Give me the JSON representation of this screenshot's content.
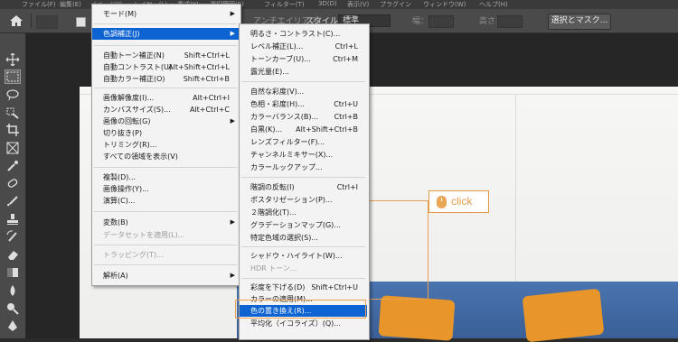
{
  "menubar": [
    "ファイル(F)",
    "編集(E)",
    "イメージ(I)",
    "レイヤー(L)",
    "書式(Y)",
    "選択範囲(S)",
    "フィルター(T)",
    "3D(D)",
    "表示(V)",
    "プラグイン",
    "ウィンドウ(W)",
    "ヘルプ(H)"
  ],
  "options": {
    "antialias": "アンチエイリアス",
    "style_label": "スタイル：",
    "style_value": "標準",
    "width_label": "幅：",
    "height_label": "高さ：",
    "select_mask": "選択とマスク..."
  },
  "image_menu": {
    "items": [
      {
        "label": "モード(M)",
        "shortcut": "",
        "submenu": true
      },
      {
        "label": "色調補正(J)",
        "shortcut": "",
        "submenu": true,
        "highlighted": true
      },
      {
        "label": "自動トーン補正(N)",
        "shortcut": "Shift+Ctrl+L"
      },
      {
        "label": "自動コントラスト(U)",
        "shortcut": "Alt+Shift+Ctrl+L"
      },
      {
        "label": "自動カラー補正(O)",
        "shortcut": "Shift+Ctrl+B"
      },
      {
        "label": "画像解像度(I)...",
        "shortcut": "Alt+Ctrl+I"
      },
      {
        "label": "カンバスサイズ(S)...",
        "shortcut": "Alt+Ctrl+C"
      },
      {
        "label": "画像の回転(G)",
        "shortcut": "",
        "submenu": true
      },
      {
        "label": "切り抜き(P)",
        "shortcut": ""
      },
      {
        "label": "トリミング(R)...",
        "shortcut": ""
      },
      {
        "label": "すべての領域を表示(V)",
        "shortcut": ""
      },
      {
        "label": "複製(D)...",
        "shortcut": ""
      },
      {
        "label": "画像操作(Y)...",
        "shortcut": ""
      },
      {
        "label": "演算(C)...",
        "shortcut": ""
      },
      {
        "label": "変数(B)",
        "shortcut": "",
        "submenu": true
      },
      {
        "label": "データセットを適用(L)...",
        "shortcut": "",
        "disabled": true
      },
      {
        "label": "トラッピング(T)...",
        "shortcut": "",
        "disabled": true
      },
      {
        "label": "解析(A)",
        "shortcut": "",
        "submenu": true
      }
    ]
  },
  "adjust_menu": {
    "items": [
      {
        "label": "明るさ・コントラスト(C)...",
        "shortcut": ""
      },
      {
        "label": "レベル補正(L)...",
        "shortcut": "Ctrl+L"
      },
      {
        "label": "トーンカーブ(U)...",
        "shortcut": "Ctrl+M"
      },
      {
        "label": "露光量(E)...",
        "shortcut": ""
      },
      {
        "label": "自然な彩度(V)...",
        "shortcut": ""
      },
      {
        "label": "色相・彩度(H)...",
        "shortcut": "Ctrl+U"
      },
      {
        "label": "カラーバランス(B)...",
        "shortcut": "Ctrl+B"
      },
      {
        "label": "白黒(K)...",
        "shortcut": "Alt+Shift+Ctrl+B"
      },
      {
        "label": "レンズフィルター(F)...",
        "shortcut": ""
      },
      {
        "label": "チャンネルミキサー(X)...",
        "shortcut": ""
      },
      {
        "label": "カラールックアップ...",
        "shortcut": ""
      },
      {
        "label": "階調の反転(I)",
        "shortcut": "Ctrl+I"
      },
      {
        "label": "ポスタリゼーション(P)...",
        "shortcut": ""
      },
      {
        "label": "２階調化(T)...",
        "shortcut": ""
      },
      {
        "label": "グラデーションマップ(G)...",
        "shortcut": ""
      },
      {
        "label": "特定色域の選択(S)...",
        "shortcut": ""
      },
      {
        "label": "シャドウ・ハイライト(W)...",
        "shortcut": ""
      },
      {
        "label": "HDR トーン...",
        "shortcut": "",
        "disabled": true
      },
      {
        "label": "彩度を下げる(D)",
        "shortcut": "Shift+Ctrl+U"
      },
      {
        "label": "カラーの適用(M)...",
        "shortcut": ""
      },
      {
        "label": "色の置き換え(R)...",
        "shortcut": "",
        "highlighted": true
      },
      {
        "label": "平均化（イコライズ）(Q)...",
        "shortcut": ""
      }
    ]
  },
  "annotation": {
    "label": "click",
    "color": "#e39a47"
  },
  "colors": {
    "highlight": "#0d63d2",
    "sofa": "#3f649c",
    "pillow": "#e8952a"
  }
}
